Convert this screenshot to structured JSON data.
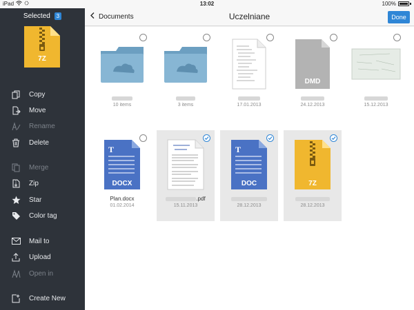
{
  "status": {
    "device": "iPad",
    "time": "13:02",
    "battery": "100%"
  },
  "sidebar": {
    "selected_label": "Selected",
    "selected_count": "3",
    "selected_icon_label": "7Z",
    "items": [
      {
        "label": "Copy",
        "icon": "copy-icon",
        "enabled": true
      },
      {
        "label": "Move",
        "icon": "move-icon",
        "enabled": true
      },
      {
        "label": "Rename",
        "icon": "rename-icon",
        "enabled": false
      },
      {
        "label": "Delete",
        "icon": "trash-icon",
        "enabled": true
      },
      {
        "label": "Merge",
        "icon": "merge-icon",
        "enabled": false
      },
      {
        "label": "Zip",
        "icon": "zip-icon",
        "enabled": true
      },
      {
        "label": "Star",
        "icon": "star-icon",
        "enabled": true
      },
      {
        "label": "Color tag",
        "icon": "tag-icon",
        "enabled": true
      },
      {
        "label": "Mail to",
        "icon": "mail-icon",
        "enabled": true
      },
      {
        "label": "Upload",
        "icon": "upload-icon",
        "enabled": true
      },
      {
        "label": "Open in",
        "icon": "open-in-icon",
        "enabled": false
      },
      {
        "label": "Create New",
        "icon": "create-new-icon",
        "enabled": true
      }
    ]
  },
  "nav": {
    "back_label": "Documents",
    "title": "Uczelniane",
    "done_label": "Done"
  },
  "files": [
    {
      "type": "folder",
      "name": "",
      "meta": "10 items",
      "selected": false
    },
    {
      "type": "folder",
      "name": "",
      "meta": "3 items",
      "selected": false
    },
    {
      "type": "page",
      "name": "",
      "meta": "17.01.2013",
      "selected": false
    },
    {
      "type": "dmd",
      "label": "DMD",
      "name": "",
      "meta": "24.12.2013",
      "selected": false
    },
    {
      "type": "image",
      "name": "",
      "meta": "15.12.2013",
      "selected": false
    },
    {
      "type": "docx",
      "label": "DOCX",
      "name": "Plan.docx",
      "meta": "01.02.2014",
      "selected": false
    },
    {
      "type": "pdf",
      "name": ".pdf",
      "meta": "15.11.2013",
      "selected": true
    },
    {
      "type": "doc",
      "label": "DOC",
      "name": "",
      "meta": "28.12.2013",
      "selected": true
    },
    {
      "type": "zip",
      "label": "7Z",
      "name": "",
      "meta": "28.12.2013",
      "selected": true
    }
  ],
  "colors": {
    "accent": "#2f86d6",
    "sidebar_bg": "#2e333a",
    "folder": "#7fb0d0",
    "doc_blue": "#4a72c4",
    "zip_yellow": "#f0b72f",
    "dmd_gray": "#b3b3b3"
  }
}
